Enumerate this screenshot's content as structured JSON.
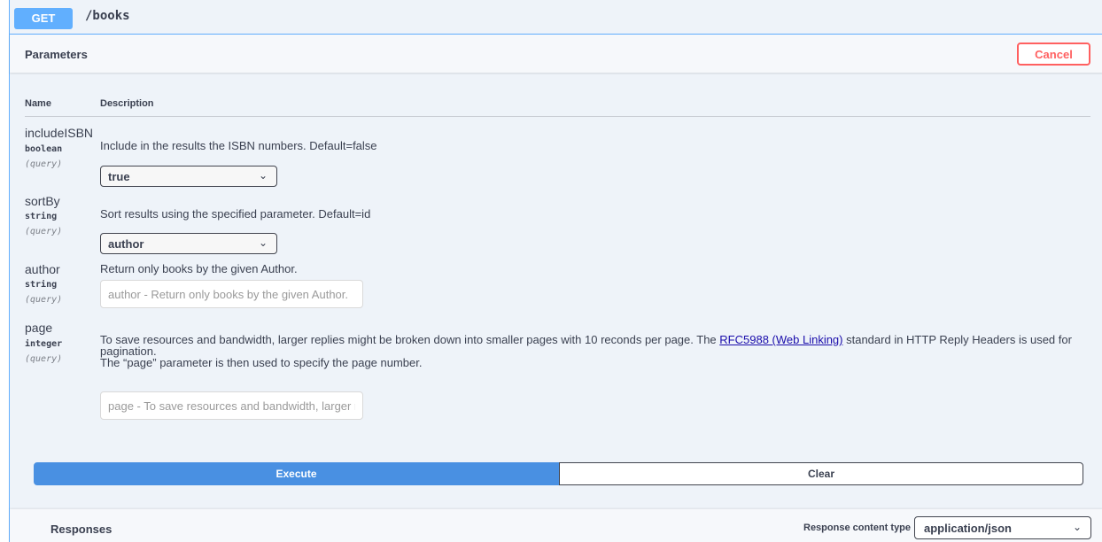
{
  "operation": {
    "method": "GET",
    "path": "/books"
  },
  "parameters_section": {
    "title": "Parameters",
    "cancel_label": "Cancel"
  },
  "columns": {
    "name": "Name",
    "description": "Description"
  },
  "params": [
    {
      "name": "includeISBN",
      "type": "boolean",
      "in": "(query)",
      "description": "Include in the results the ISBN numbers. Default=false",
      "control": "select",
      "selected": "true",
      "chevron_icon": "chevron-down-icon"
    },
    {
      "name": "sortBy",
      "type": "string",
      "in": "(query)",
      "description": "Sort results using the specified parameter. Default=id",
      "control": "select",
      "selected": "author",
      "chevron_icon": "chevron-down-icon"
    },
    {
      "name": "author",
      "type": "string",
      "in": "(query)",
      "description": "Return only books by the given Author.",
      "control": "input",
      "placeholder": "author - Return only books by the given Author.",
      "value": ""
    },
    {
      "name": "page",
      "type": "integer",
      "in": "(query)",
      "description_before_link": "To save resources and bandwidth, larger replies might be broken down into smaller pages with 10 reconds per page. The ",
      "description_link": "RFC5988 (Web Linking)",
      "description_after_link": " standard in HTTP Reply Headers is used for pagination.",
      "description_line2": "The “page” parameter is then used to specify the page number.",
      "control": "input",
      "placeholder": "page - To save resources and bandwidth, larger replies might be broken down into smaller pages",
      "value": ""
    }
  ],
  "actions": {
    "execute_label": "Execute",
    "clear_label": "Clear"
  },
  "responses": {
    "title": "Responses",
    "content_type_label": "Response content type",
    "content_type_value": "application/json"
  },
  "colors": {
    "get_method": "#61affe",
    "cancel": "#ff6060",
    "execute": "#4990e2",
    "panel_bg": "#eef3f9"
  }
}
